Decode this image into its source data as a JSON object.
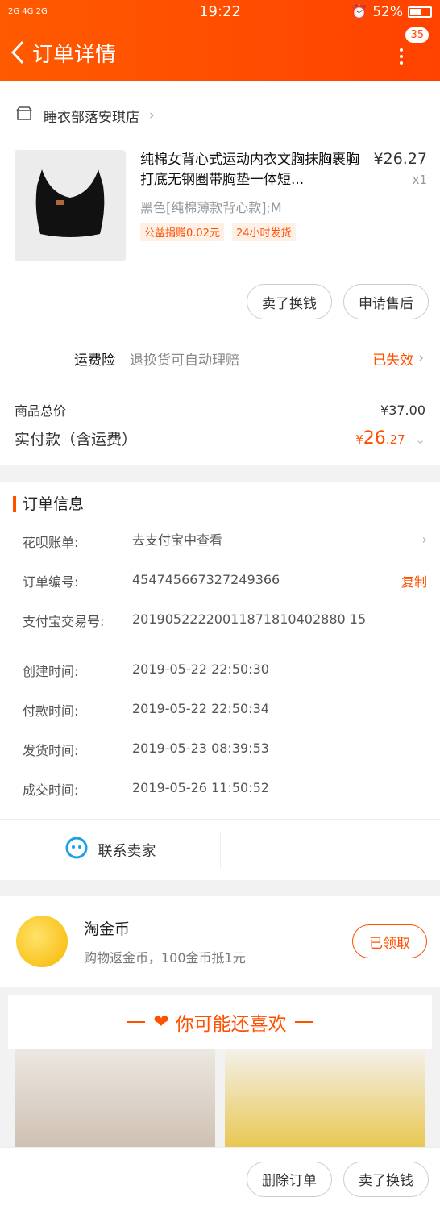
{
  "status": {
    "signal": "2G 4G 2G",
    "time": "19:22",
    "battery": "52%"
  },
  "navbar": {
    "title": "订单详情",
    "badge": "35"
  },
  "shop": {
    "name": "睡衣部落安琪店"
  },
  "product": {
    "title": "纯棉女背心式运动内衣文胸抹胸裹胸打底无钢圈带胸垫一体短...",
    "sku": "黑色[纯棉薄款背心款];M",
    "tags": [
      "公益捐赠0.02元",
      "24小时发货"
    ],
    "price": "¥26.27",
    "qty": "x1"
  },
  "actions": {
    "sell_exchange": "卖了换钱",
    "after_sale": "申请售后"
  },
  "freight": {
    "label": "运费险",
    "desc": "退换货可自动理赔",
    "state": "已失效"
  },
  "summary": {
    "goods_total_label": "商品总价",
    "goods_total": "¥37.00",
    "paid_label": "实付款（含运费）",
    "paid_currency": "¥",
    "paid_int": "26",
    "paid_dec": ".27"
  },
  "order_info": {
    "title": "订单信息",
    "rows": [
      {
        "k": "花呗账单:",
        "v": "去支付宝中查看"
      },
      {
        "k": "订单编号:",
        "v": "454745667327249366",
        "a": "复制"
      },
      {
        "k": "支付宝交易号:",
        "v": "20190522220011871810402880 15"
      },
      {
        "k": "创建时间:",
        "v": "2019-05-22 22:50:30"
      },
      {
        "k": "付款时间:",
        "v": "2019-05-22 22:50:34"
      },
      {
        "k": "发货时间:",
        "v": "2019-05-23 08:39:53"
      },
      {
        "k": "成交时间:",
        "v": "2019-05-26 11:50:52"
      }
    ]
  },
  "contact": {
    "label": "联系卖家"
  },
  "coin": {
    "title": "淘金币",
    "desc": "购物返金币，100金币抵1元",
    "button": "已领取"
  },
  "recommend": {
    "title": "你可能还喜欢"
  },
  "bottom": {
    "delete": "删除订单",
    "sell": "卖了换钱"
  },
  "colors": {
    "accent": "#ff5000",
    "header": "#ff4a00"
  }
}
